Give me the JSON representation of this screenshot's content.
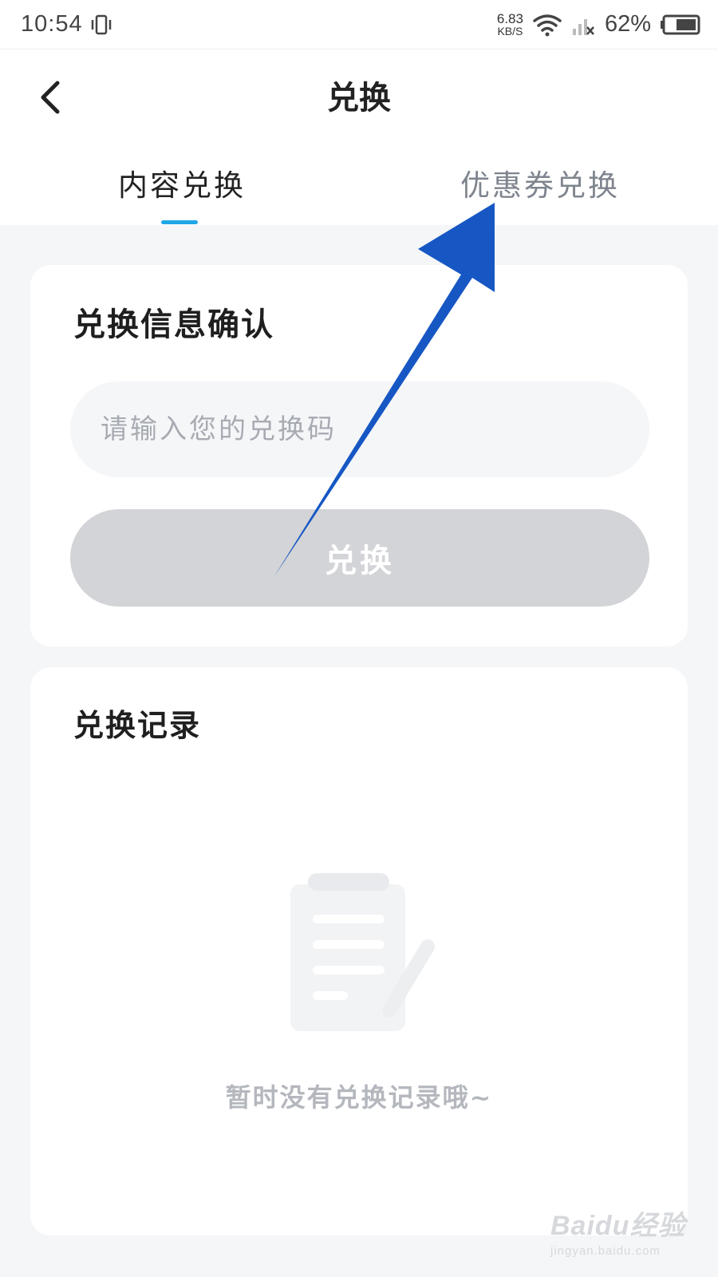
{
  "status_bar": {
    "time": "10:54",
    "net_speed_value": "6.83",
    "net_speed_unit": "KB/S",
    "battery": "62%"
  },
  "header": {
    "title": "兑换",
    "tabs": [
      {
        "label": "内容兑换",
        "active": true
      },
      {
        "label": "优惠券兑换",
        "active": false
      }
    ]
  },
  "confirm_card": {
    "title": "兑换信息确认",
    "input_placeholder": "请输入您的兑换码",
    "input_value": "",
    "button_label": "兑换"
  },
  "record_card": {
    "title": "兑换记录",
    "empty_text": "暂时没有兑换记录哦~",
    "empty_icon": "clipboard-empty-icon"
  },
  "watermark": {
    "brand": "Baidu经验",
    "site": "jingyan.baidu.com"
  },
  "colors": {
    "accent": "#1fa8e6",
    "annotation_arrow": "#1757c4",
    "disabled_button": "#d3d4d7",
    "page_bg": "#f5f6f8"
  }
}
